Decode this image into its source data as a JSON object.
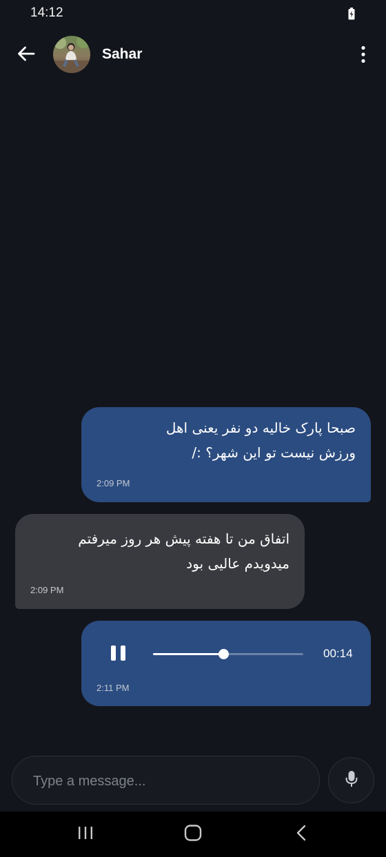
{
  "status_bar": {
    "time": "14:12"
  },
  "header": {
    "contact_name": "Sahar"
  },
  "messages": [
    {
      "direction": "outgoing",
      "lines": [
        "صبحا پارک خالیه دو نفر یعنی اهل",
        "ورزش نیست تو این شهر؟ :/"
      ],
      "time": "2:09 PM"
    },
    {
      "direction": "incoming",
      "lines": [
        "اتفاق من تا هفته پیش هر روز میرفتم",
        "میدویدم عالیی بود"
      ],
      "time": "2:09 PM"
    },
    {
      "direction": "outgoing",
      "type": "voice",
      "state": "playing",
      "progress": 0.47,
      "duration": "00:14",
      "time": "2:11 PM"
    }
  ],
  "composer": {
    "placeholder": "Type a message..."
  },
  "colors": {
    "background": "#13151c",
    "outgoing_bubble": "#2b4c80",
    "incoming_bubble": "#393a3f"
  },
  "icons": {
    "back": "arrow-left-icon",
    "more": "more-vertical-icon",
    "pause": "pause-icon",
    "mic": "microphone-icon",
    "battery": "battery-charging-icon",
    "nav_recents": "recents-icon",
    "nav_home": "home-icon",
    "nav_back": "back-chevron-icon"
  }
}
